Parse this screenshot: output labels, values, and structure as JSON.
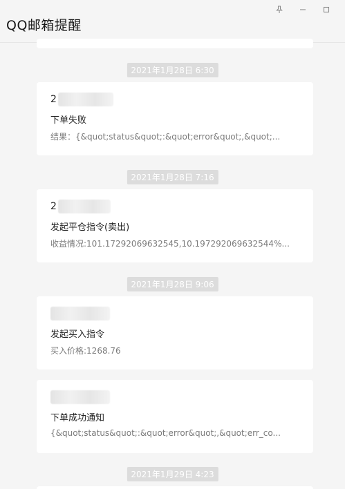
{
  "app": {
    "title": "QQ邮箱提醒"
  },
  "window_controls": {
    "pin_icon": "pin-icon",
    "minimize_icon": "minimize-icon",
    "maximize_icon": "maximize-icon"
  },
  "messages": [
    {
      "time": "2021年1月28日 6:30",
      "sender_prefix": "2",
      "subject": "下单失败",
      "preview": "结果：{&quot;status&quot;:&quot;error&quot;,&quot;..."
    },
    {
      "time": "2021年1月28日 7:16",
      "sender_prefix": "2",
      "subject": "发起平仓指令(卖出)",
      "preview": "收益情况:101.17292069632545,10.197292069632544%..."
    },
    {
      "time": "2021年1月28日 9:06",
      "sender_prefix": "",
      "subject": "发起买入指令",
      "preview": "买入价格:1268.76"
    },
    {
      "time": "",
      "sender_prefix": "",
      "subject": "下单成功通知",
      "preview": "{&quot;status&quot;:&quot;error&quot;,&quot;err_co..."
    }
  ],
  "bottom_time": "2021年1月29日 4:23"
}
